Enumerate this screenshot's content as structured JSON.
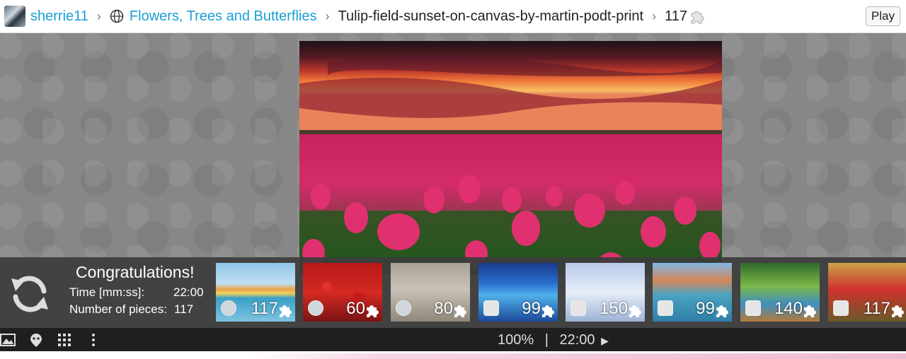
{
  "header": {
    "username": "sherrie11",
    "category": "Flowers, Trees and Butterflies",
    "puzzle_title": "Tulip-field-sunset-on-canvas-by-martin-podt-print",
    "piece_count": "117",
    "play_label": "Play",
    "link_color": "#1a9fd4"
  },
  "panel": {
    "congrats": "Congratulations!",
    "time_label": "Time [mm:ss]:",
    "time_value": "22:00",
    "pieces_label": "Number of pieces:",
    "pieces_value": "117"
  },
  "thumbnails": [
    {
      "count": "117",
      "theme": "pastel houses"
    },
    {
      "count": "60",
      "theme": "red tulips"
    },
    {
      "count": "80",
      "theme": "cranes"
    },
    {
      "count": "99",
      "theme": "blue fantasy"
    },
    {
      "count": "150",
      "theme": "winter trees"
    },
    {
      "count": "99",
      "theme": "mountain lake"
    },
    {
      "count": "140",
      "theme": "forest boardwalk"
    },
    {
      "count": "117",
      "theme": "autumn forest"
    }
  ],
  "toolbar": {
    "zoom": "100%",
    "separator": "|",
    "time": "22:00"
  },
  "icons": [
    "avatar",
    "globe-icon",
    "puzzle-piece-icon",
    "refresh-icon",
    "image-icon",
    "ghost-icon",
    "grid-icon",
    "more-icon",
    "play-arrow-icon"
  ]
}
